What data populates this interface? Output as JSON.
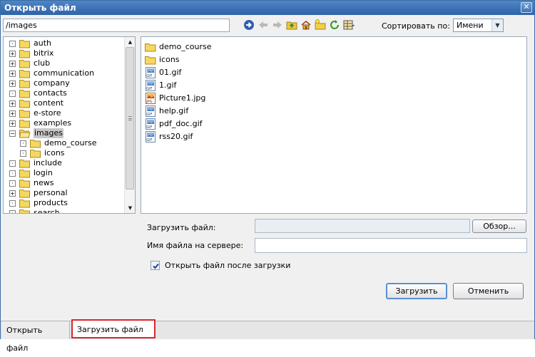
{
  "window": {
    "title": "Открыть файл",
    "close_icon": "close-icon"
  },
  "path": {
    "value": "/images"
  },
  "toolbar": {
    "icons": [
      "go-icon",
      "back-icon",
      "forward-icon",
      "folder-up-icon",
      "home-icon",
      "new-folder-icon",
      "refresh-icon",
      "view-mode-icon"
    ]
  },
  "sort": {
    "label": "Сортировать по:",
    "value": "Имени"
  },
  "tree": {
    "items": [
      {
        "label": "auth",
        "expander": "⊡",
        "level": 0
      },
      {
        "label": "bitrix",
        "expander": "+",
        "level": 0
      },
      {
        "label": "club",
        "expander": "+",
        "level": 0
      },
      {
        "label": "communication",
        "expander": "+",
        "level": 0
      },
      {
        "label": "company",
        "expander": "+",
        "level": 0
      },
      {
        "label": "contacts",
        "expander": "·",
        "level": 0
      },
      {
        "label": "content",
        "expander": "+",
        "level": 0
      },
      {
        "label": "e-store",
        "expander": "+",
        "level": 0
      },
      {
        "label": "examples",
        "expander": "+",
        "level": 0
      },
      {
        "label": "images",
        "expander": "−",
        "level": 0,
        "selected": true,
        "open": true
      },
      {
        "label": "demo_course",
        "expander": "·",
        "level": 1
      },
      {
        "label": "icons",
        "expander": "·",
        "level": 1
      },
      {
        "label": "include",
        "expander": "·",
        "level": 0
      },
      {
        "label": "login",
        "expander": "·",
        "level": 0
      },
      {
        "label": "news",
        "expander": "·",
        "level": 0
      },
      {
        "label": "personal",
        "expander": "+",
        "level": 0
      },
      {
        "label": "products",
        "expander": "·",
        "level": 0
      },
      {
        "label": "search",
        "expander": "·",
        "level": 0
      }
    ]
  },
  "files": {
    "items": [
      {
        "name": "demo_course",
        "icon": "folder-icon"
      },
      {
        "name": "icons",
        "icon": "folder-icon"
      },
      {
        "name": "01.gif",
        "icon": "gif-file-icon"
      },
      {
        "name": "1.gif",
        "icon": "gif-file-icon"
      },
      {
        "name": "Picture1.jpg",
        "icon": "jpg-file-icon"
      },
      {
        "name": "help.gif",
        "icon": "gif-file-icon"
      },
      {
        "name": "pdf_doc.gif",
        "icon": "gif-file-icon"
      },
      {
        "name": "rss20.gif",
        "icon": "gif-file-icon"
      }
    ]
  },
  "upload": {
    "file_label": "Загрузить файл:",
    "file_value": "",
    "browse_label": "Обзор...",
    "server_name_label": "Имя файла на сервере:",
    "server_name_value": "",
    "open_after_label": "Открыть файл после загрузки",
    "open_after_checked": true,
    "submit_label": "Загрузить",
    "cancel_label": "Отменить"
  },
  "tabs": {
    "open_label": "Открыть файл",
    "upload_label": "Загрузить файл",
    "active": "upload"
  }
}
